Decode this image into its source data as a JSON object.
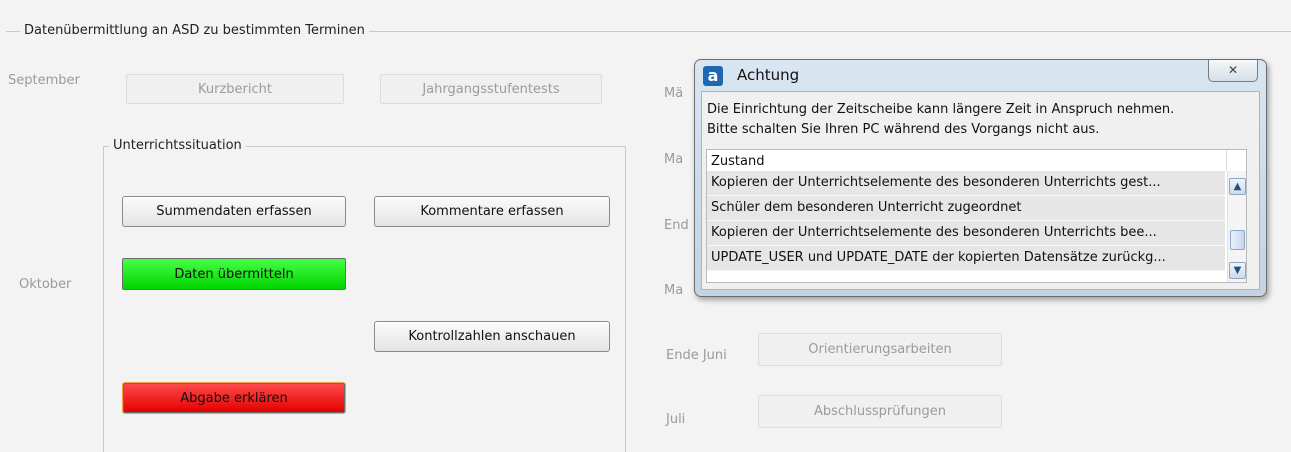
{
  "group": {
    "legend": "Datenübermittlung an ASD zu bestimmten Terminen"
  },
  "left": {
    "september_label": "September",
    "oktober_label": "Oktober",
    "kurzbericht": "Kurzbericht",
    "jahrgangsstufentests": "Jahrgangsstufentests"
  },
  "unterricht": {
    "legend": "Unterrichtssituation",
    "summendaten": "Summendaten erfassen",
    "kommentare": "Kommentare erfassen",
    "daten_uebermitteln": "Daten übermitteln",
    "kontrollzahlen": "Kontrollzahlen anschauen",
    "abgabe": "Abgabe erklären"
  },
  "right": {
    "partial_labels": [
      "Mä",
      "Ma",
      "End",
      "Ma"
    ],
    "ende_juni_label": "Ende Juni",
    "juli_label": "Juli",
    "orientierungsarbeiten": "Orientierungsarbeiten",
    "abschlusspruefungen": "Abschlussprüfungen"
  },
  "dialog": {
    "icon_letter": "a",
    "title": "Achtung",
    "close_symbol": "✕",
    "message_line1": "Die Einrichtung der Zeitscheibe kann längere Zeit in Anspruch nehmen.",
    "message_line2": "Bitte schalten Sie Ihren PC während des Vorgangs nicht aus.",
    "list_header": "Zustand",
    "rows": [
      "Kopieren der Unterrichtselemente des besonderen Unterrichts gest...",
      "Schüler dem besonderen Unterricht zugeordnet",
      "Kopieren der Unterrichtselemente des besonderen Unterrichts bee...",
      "UPDATE_USER und UPDATE_DATE der kopierten Datensätze zurückg..."
    ],
    "scroll_up_symbol": "▲",
    "scroll_down_symbol": "▼"
  }
}
